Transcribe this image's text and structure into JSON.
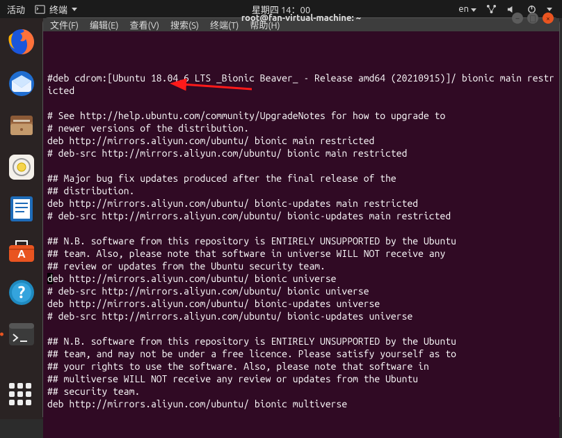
{
  "top_panel": {
    "activities": "活动",
    "app_indicator": "终端",
    "clock": "星期四 14：00",
    "lang": "en"
  },
  "dock": {
    "firefox": "firefox-icon",
    "thunderbird": "thunderbird-icon",
    "files": "files-icon",
    "rhythmbox": "rhythmbox-icon",
    "writer": "writer-icon",
    "software": "software-icon",
    "help": "help-icon",
    "terminal": "terminal-icon",
    "apps": "apps-icon"
  },
  "window": {
    "title": "root@fan-virtual-machine: ~",
    "menubar": {
      "file": "文件(F)",
      "edit": "编辑(E)",
      "view": "查看(V)",
      "search": "搜索(S)",
      "terminal": "终端(T)",
      "help": "帮助(H)"
    },
    "controls": {
      "min": "–",
      "max": "□",
      "close": "×"
    }
  },
  "terminal_lines": [
    "#deb cdrom:[Ubuntu 18.04.6 LTS _Bionic Beaver_ - Release amd64 (20210915)]/ bionic main restricted",
    "",
    "# See http://help.ubuntu.com/community/UpgradeNotes for how to upgrade to",
    "# newer versions of the distribution.",
    "deb http://mirrors.aliyun.com/ubuntu/ bionic main restricted",
    "# deb-src http://mirrors.aliyun.com/ubuntu/ bionic main restricted",
    "",
    "## Major bug fix updates produced after the final release of the",
    "## distribution.",
    "deb http://mirrors.aliyun.com/ubuntu/ bionic-updates main restricted",
    "# deb-src http://mirrors.aliyun.com/ubuntu/ bionic-updates main restricted",
    "",
    "## N.B. software from this repository is ENTIRELY UNSUPPORTED by the Ubuntu",
    "## team. Also, please note that software in universe WILL NOT receive any",
    "## review or updates from the Ubuntu security team.",
    "deb http://mirrors.aliyun.com/ubuntu/ bionic universe",
    "# deb-src http://mirrors.aliyun.com/ubuntu/ bionic universe",
    "deb http://mirrors.aliyun.com/ubuntu/ bionic-updates universe",
    "# deb-src http://mirrors.aliyun.com/ubuntu/ bionic-updates universe",
    "",
    "## N.B. software from this repository is ENTIRELY UNSUPPORTED by the Ubuntu",
    "## team, and may not be under a free licence. Please satisfy yourself as to",
    "## your rights to use the software. Also, please note that software in",
    "## multiverse WILL NOT receive any review or updates from the Ubuntu",
    "## security team.",
    "deb http://mirrors.aliyun.com/ubuntu/ bionic multiverse"
  ],
  "highlight_line_index": 15,
  "highlight_char_index": 0
}
